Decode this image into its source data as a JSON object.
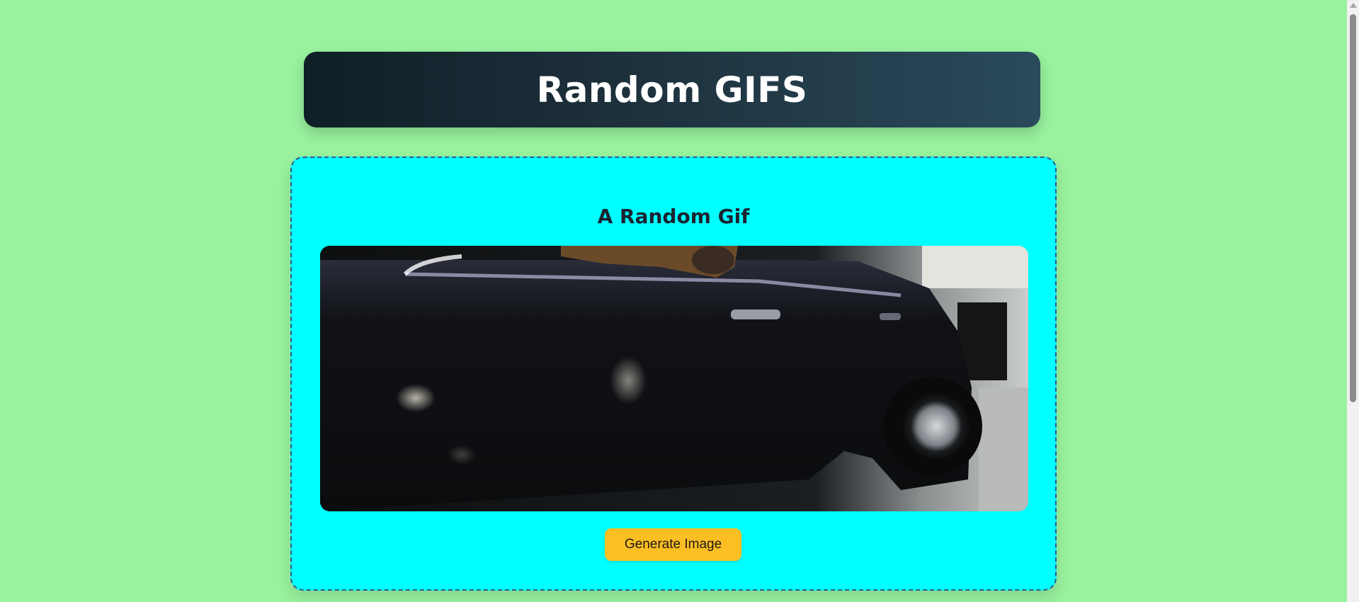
{
  "header": {
    "title": "Random GIFS"
  },
  "card": {
    "title": "A Random Gif",
    "image_alt": "random gif: dog in a black car",
    "button_label": "Generate Image"
  },
  "colors": {
    "page_background": "#98f29e",
    "card_background": "#00ffff",
    "button_background": "#fbbf24",
    "header_gradient_start": "#0f1f27",
    "header_gradient_end": "#2a4a5c"
  }
}
